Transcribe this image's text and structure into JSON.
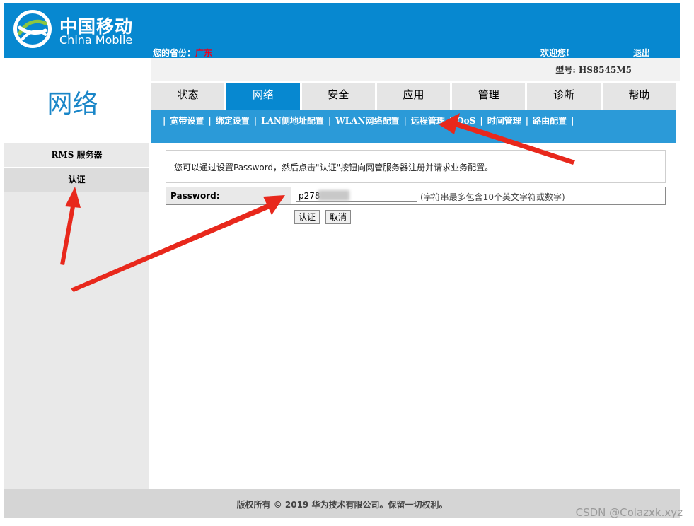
{
  "header": {
    "brand_cn": "中国移动",
    "brand_en": "China Mobile",
    "province_label": "您的省份：",
    "province_value": "广东",
    "welcome": "欢迎您!",
    "logout": "退出",
    "logo_icon": "china-mobile-logo",
    "bg_color": "#0788d0"
  },
  "model": {
    "text": "型号: HS8545M5"
  },
  "section": {
    "title": "网络"
  },
  "sidebar": {
    "items": [
      {
        "label": "RMS 服务器",
        "active": false
      },
      {
        "label": "认证",
        "active": true
      }
    ]
  },
  "tabs": [
    {
      "label": "状态",
      "active": false
    },
    {
      "label": "网络",
      "active": true
    },
    {
      "label": "安全",
      "active": false
    },
    {
      "label": "应用",
      "active": false
    },
    {
      "label": "管理",
      "active": false
    },
    {
      "label": "诊断",
      "active": false
    },
    {
      "label": "帮助",
      "active": false
    }
  ],
  "subnav": [
    {
      "label": "宽带设置"
    },
    {
      "label": "绑定设置"
    },
    {
      "label": "LAN侧地址配置"
    },
    {
      "label": "WLAN网络配置"
    },
    {
      "label": "远程管理"
    },
    {
      "label": "QoS"
    },
    {
      "label": "时间管理"
    },
    {
      "label": "路由配置"
    }
  ],
  "content": {
    "note": "您可以通过设置Password，然后点击\"认证\"按钮向网管服务器注册并请求业务配置。",
    "password_label": "Password:",
    "password_value": "p278",
    "hint": "(字符串最多包含10个英文字符或数字)",
    "auth_button": "认证",
    "cancel_button": "取消"
  },
  "footer": {
    "copyright": "版权所有 © 2019 华为技术有限公司。保留一切权利。"
  },
  "watermark": "CSDN @Colazxk.xyz",
  "annotation_color": "#e8281c"
}
